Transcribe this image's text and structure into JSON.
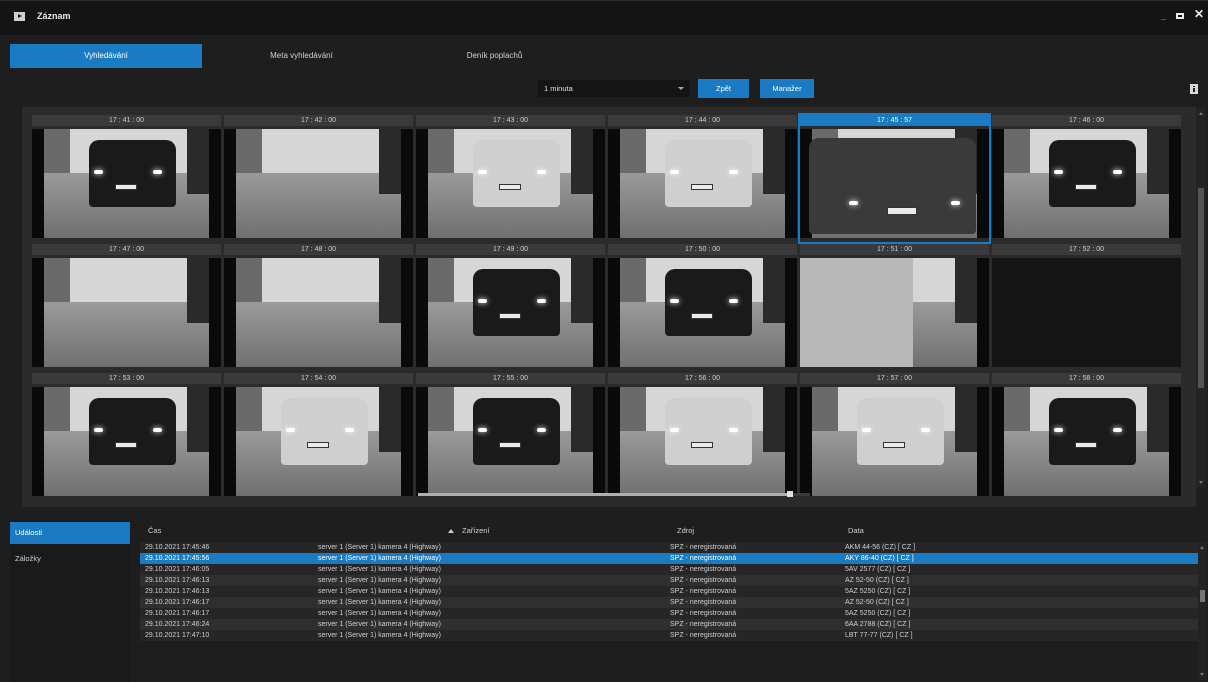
{
  "window": {
    "title": "Záznam",
    "icon": "play-icon"
  },
  "tabs": [
    {
      "label": "Vyhledávání",
      "active": true
    },
    {
      "label": "Meta vyhledávání",
      "active": false
    },
    {
      "label": "Deník poplachů",
      "active": false
    }
  ],
  "toolbar": {
    "interval": "1 minuta",
    "back_label": "Zpět",
    "manager_label": "Manažer",
    "info_icon": "info-icon"
  },
  "thumbnails": [
    {
      "time": "17 : 41 : 00"
    },
    {
      "time": "17 : 42 : 00"
    },
    {
      "time": "17 : 43 : 00"
    },
    {
      "time": "17 : 44 : 00"
    },
    {
      "time": "17 : 45 : 57",
      "selected": true
    },
    {
      "time": "17 : 46 : 00"
    },
    {
      "time": "17 : 47 : 00"
    },
    {
      "time": "17 : 48 : 00"
    },
    {
      "time": "17 : 49 : 00"
    },
    {
      "time": "17 : 50 : 00"
    },
    {
      "time": "17 : 51 : 00"
    },
    {
      "time": "17 : 52 : 00"
    },
    {
      "time": "17 : 53 : 00"
    },
    {
      "time": "17 : 54 : 00"
    },
    {
      "time": "17 : 55 : 00"
    },
    {
      "time": "17 : 56 : 00"
    },
    {
      "time": "17 : 57 : 00"
    },
    {
      "time": "17 : 58 : 00"
    }
  ],
  "side_tabs": [
    {
      "label": "Události",
      "active": true
    },
    {
      "label": "Záložky",
      "active": false
    }
  ],
  "table": {
    "columns": [
      "Čas",
      "Zařízení",
      "Zdroj",
      "Data"
    ],
    "rows": [
      {
        "time": "29.10.2021 17:45:46",
        "device": "server 1 (Server 1)  kamera 4 (Highway)",
        "source": "SPZ - neregistrovaná",
        "data": "AKM 44-56 (CZ) [ CZ ]"
      },
      {
        "time": "29.10.2021 17:45:56",
        "device": "server 1 (Server 1)  kamera 4 (Highway)",
        "source": "SPZ - neregistrovaná",
        "data": "AKY 86-40 (CZ) [ CZ ]",
        "selected": true
      },
      {
        "time": "29.10.2021 17:46:05",
        "device": "server 1 (Server 1)  kamera 4 (Highway)",
        "source": "SPZ - neregistrovaná",
        "data": "5AV 2577 (CZ) [ CZ ]"
      },
      {
        "time": "29.10.2021 17:46:13",
        "device": "server 1 (Server 1)  kamera 4 (Highway)",
        "source": "SPZ - neregistrovaná",
        "data": "AZ 52-50 (CZ) [ CZ ]"
      },
      {
        "time": "29.10.2021 17:46:13",
        "device": "server 1 (Server 1)  kamera 4 (Highway)",
        "source": "SPZ - neregistrovaná",
        "data": "5AZ 5250 (CZ) [ CZ ]"
      },
      {
        "time": "29.10.2021 17:46:17",
        "device": "server 1 (Server 1)  kamera 4 (Highway)",
        "source": "SPZ - neregistrovaná",
        "data": "AZ 52-50 (CZ) [ CZ ]"
      },
      {
        "time": "29.10.2021 17:46:17",
        "device": "server 1 (Server 1)  kamera 4 (Highway)",
        "source": "SPZ - neregistrovaná",
        "data": "5AZ 5250 (CZ) [ CZ ]"
      },
      {
        "time": "29.10.2021 17:46:24",
        "device": "server 1 (Server 1)  kamera 4 (Highway)",
        "source": "SPZ - neregistrovaná",
        "data": "6AA 2788 (CZ) [ CZ ]"
      },
      {
        "time": "29.10.2021 17:47:10",
        "device": "server 1 (Server 1)  kamera 4 (Highway)",
        "source": "SPZ - neregistrovaná",
        "data": "LBT 77-77 (CZ) [ CZ ]"
      }
    ]
  },
  "colors": {
    "accent": "#1a7bc4",
    "background": "#1e1e1e",
    "panel": "#2b2b2b"
  }
}
